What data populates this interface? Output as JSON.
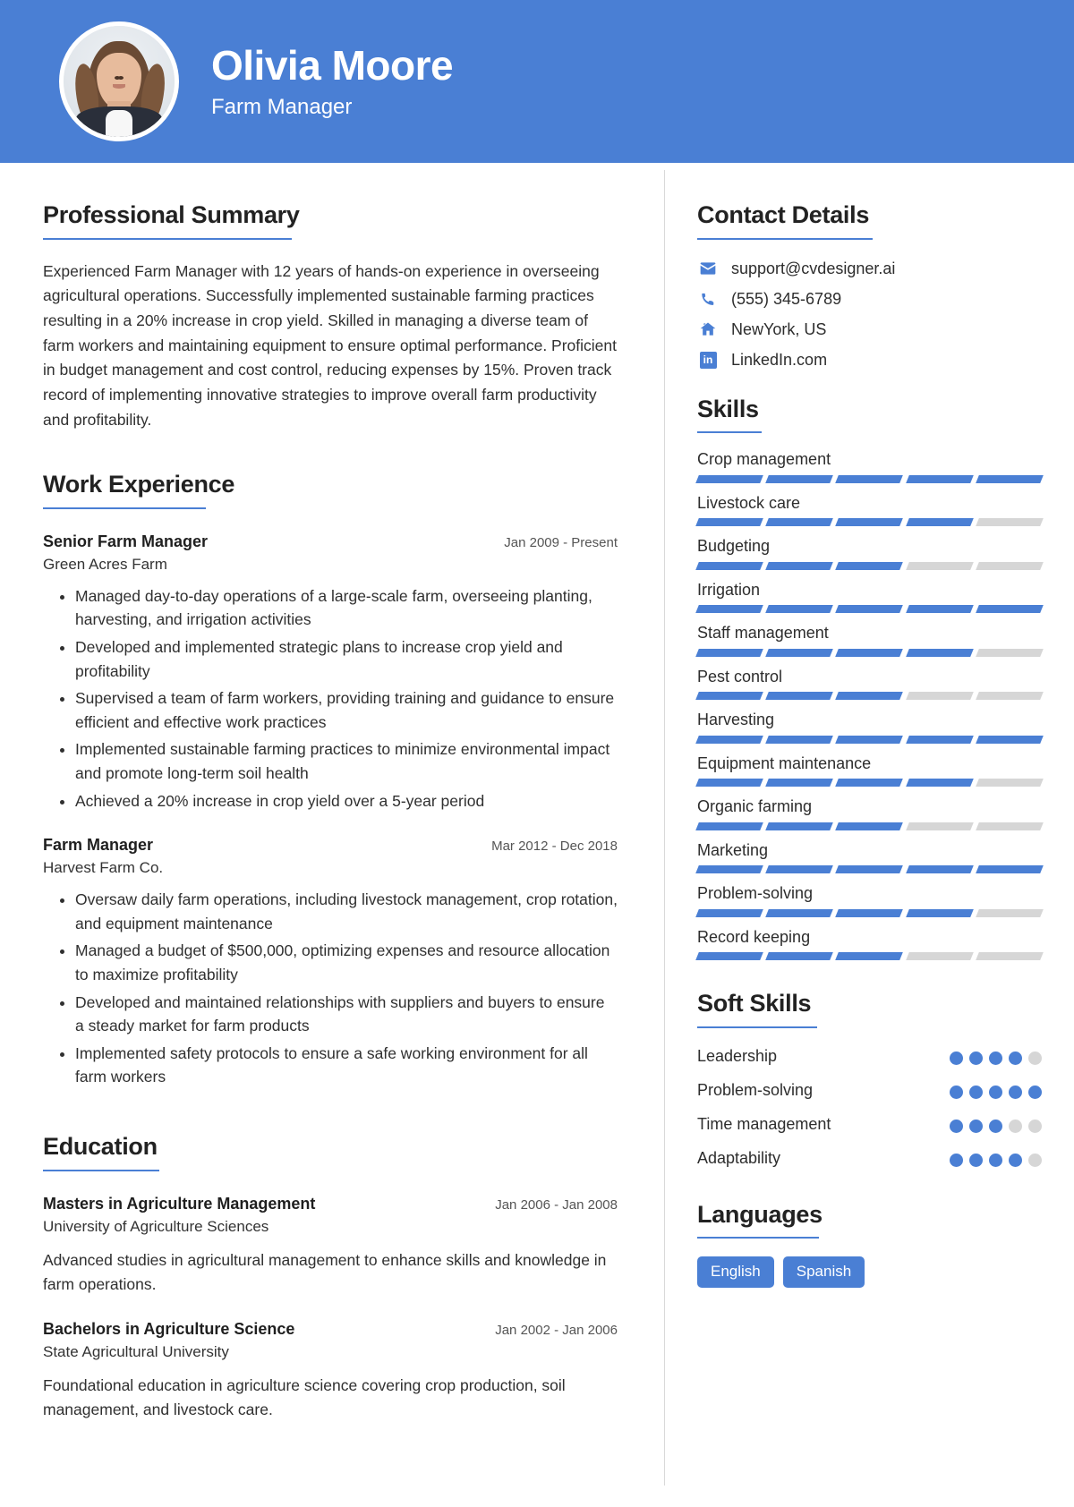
{
  "theme": {
    "accent": "#4a7fd4",
    "track": "#d6d6d6",
    "text": "#2d2d2d"
  },
  "header": {
    "name": "Olivia Moore",
    "job_title": "Farm Manager",
    "avatar_alt": "profile-photo"
  },
  "main": {
    "summary": {
      "heading": "Professional Summary",
      "text": "Experienced Farm Manager with 12 years of hands-on experience in overseeing agricultural operations. Successfully implemented sustainable farming practices resulting in a 20% increase in crop yield. Skilled in managing a diverse team of farm workers and maintaining equipment to ensure optimal performance. Proficient in budget management and cost control, reducing expenses by 15%. Proven track record of implementing innovative strategies to improve overall farm productivity and profitability."
    },
    "work": {
      "heading": "Work Experience",
      "entries": [
        {
          "role": "Senior Farm Manager",
          "date": "Jan 2009 - Present",
          "org": "Green Acres Farm",
          "bullets": [
            "Managed day-to-day operations of a large-scale farm, overseeing planting, harvesting, and irrigation activities",
            "Developed and implemented strategic plans to increase crop yield and profitability",
            "Supervised a team of farm workers, providing training and guidance to ensure efficient and effective work practices",
            "Implemented sustainable farming practices to minimize environmental impact and promote long-term soil health",
            "Achieved a 20% increase in crop yield over a 5-year period"
          ]
        },
        {
          "role": "Farm Manager",
          "date": "Mar 2012 - Dec 2018",
          "org": "Harvest Farm Co.",
          "bullets": [
            "Oversaw daily farm operations, including livestock management, crop rotation, and equipment maintenance",
            "Managed a budget of $500,000, optimizing expenses and resource allocation to maximize profitability",
            "Developed and maintained relationships with suppliers and buyers to ensure a steady market for farm products",
            "Implemented safety protocols to ensure a safe working environment for all farm workers"
          ]
        }
      ]
    },
    "education": {
      "heading": "Education",
      "entries": [
        {
          "degree": "Masters in Agriculture Management",
          "date": "Jan 2006 - Jan 2008",
          "school": "University of Agriculture Sciences",
          "description": "Advanced studies in agricultural management to enhance skills and knowledge in farm operations."
        },
        {
          "degree": "Bachelors in Agriculture Science",
          "date": "Jan 2002 - Jan 2006",
          "school": "State Agricultural University",
          "description": "Foundational education in agriculture science covering crop production, soil management, and livestock care."
        }
      ]
    }
  },
  "sidebar": {
    "contact": {
      "heading": "Contact Details",
      "items": [
        {
          "icon": "envelope-icon",
          "value": "support@cvdesigner.ai"
        },
        {
          "icon": "phone-icon",
          "value": "(555) 345-6789"
        },
        {
          "icon": "home-icon",
          "value": "NewYork, US"
        },
        {
          "icon": "linkedin-icon",
          "value": "LinkedIn.com"
        }
      ]
    },
    "skills": {
      "heading": "Skills",
      "max": 5,
      "items": [
        {
          "name": "Crop management",
          "level": 5
        },
        {
          "name": "Livestock care",
          "level": 4
        },
        {
          "name": "Budgeting",
          "level": 3
        },
        {
          "name": "Irrigation",
          "level": 5
        },
        {
          "name": "Staff management",
          "level": 4
        },
        {
          "name": "Pest control",
          "level": 3
        },
        {
          "name": "Harvesting",
          "level": 5
        },
        {
          "name": "Equipment maintenance",
          "level": 4
        },
        {
          "name": "Organic farming",
          "level": 3
        },
        {
          "name": "Marketing",
          "level": 5
        },
        {
          "name": "Problem-solving",
          "level": 4
        },
        {
          "name": "Record keeping",
          "level": 3
        }
      ]
    },
    "soft_skills": {
      "heading": "Soft Skills",
      "max": 5,
      "items": [
        {
          "name": "Leadership",
          "level": 4
        },
        {
          "name": "Problem-solving",
          "level": 5
        },
        {
          "name": "Time management",
          "level": 3
        },
        {
          "name": "Adaptability",
          "level": 4
        }
      ]
    },
    "languages": {
      "heading": "Languages",
      "items": [
        "English",
        "Spanish"
      ]
    }
  }
}
